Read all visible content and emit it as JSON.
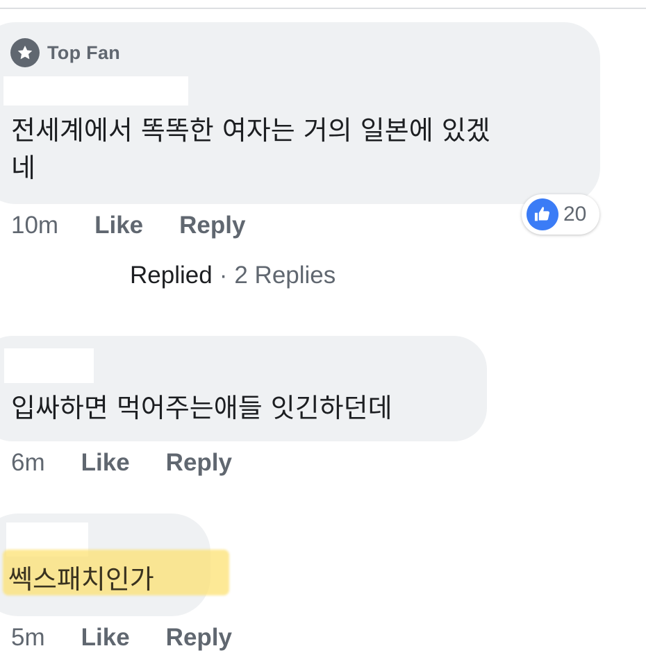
{
  "comments": [
    {
      "badge": "Top Fan",
      "text_lines": [
        "전세계에서 똑똑한 여자는 거의 일본에 있겠",
        "네"
      ],
      "time": "10m",
      "like_label": "Like",
      "reply_label": "Reply",
      "reaction_count": "20",
      "replied_label": "Replied",
      "separator": "·",
      "replies_label": "2 Replies"
    },
    {
      "text": "입싸하면 먹어주는애들 잇긴하던데",
      "time": "6m",
      "like_label": "Like",
      "reply_label": "Reply"
    },
    {
      "text": "쎅스패치인가",
      "time": "5m",
      "like_label": "Like",
      "reply_label": "Reply",
      "highlight_color": "#fce06e"
    }
  ],
  "colors": {
    "bubble": "#eff1f3",
    "secondary_text": "#606770",
    "primary_text": "#1c1e21",
    "like_blue": "#3b7cf6",
    "badge_icon": "#606770"
  },
  "icons": {
    "badge": "star-icon",
    "reaction": "thumbs-up-icon"
  }
}
